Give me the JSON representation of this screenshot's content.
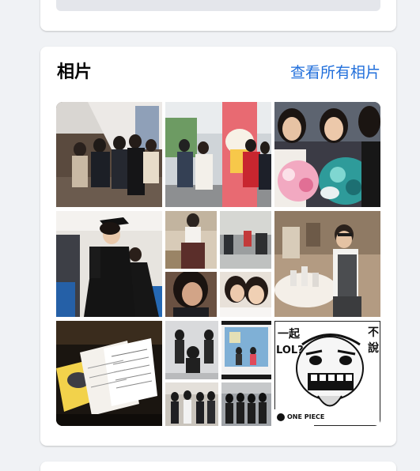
{
  "photos_card": {
    "title": "相片",
    "see_all_label": "查看所有相片",
    "see_all_color": "#216fdb"
  },
  "photos": [
    {
      "name": "photo-stairs-group",
      "kind": "single"
    },
    {
      "name": "photo-mascot-group",
      "kind": "single"
    },
    {
      "name": "photo-flowers-girls",
      "kind": "single"
    },
    {
      "name": "photo-graduation-gown",
      "kind": "single"
    },
    {
      "name": "photo-collage-restaurant",
      "kind": "collage"
    },
    {
      "name": "photo-banquet-man",
      "kind": "single"
    },
    {
      "name": "photo-receipts",
      "kind": "single"
    },
    {
      "name": "photo-collage-dance",
      "kind": "collage"
    },
    {
      "name": "photo-comic-page",
      "kind": "single"
    }
  ],
  "comic": {
    "text_left_top": "一起",
    "text_left_mid": "LOL?",
    "text_right_top": "不",
    "text_right_mid": "說",
    "logo_text": "ONE PIECE"
  }
}
